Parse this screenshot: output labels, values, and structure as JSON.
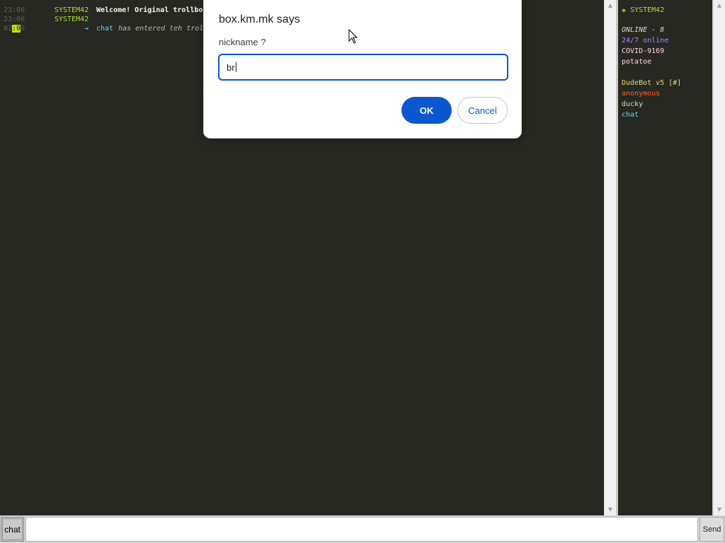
{
  "chat_log": [
    {
      "time": "23:06",
      "nick": "SYSTEM42",
      "nick_color": "#a6e22e",
      "text": "Welcome! Original trollbo"
    },
    {
      "time": "23:06",
      "nick": "SYSTEM42",
      "nick_color": "#a6e22e",
      "text": ""
    },
    {
      "time_pre": "02",
      "time_hl": ":0",
      "time_post": "6",
      "arrow": "→",
      "nick": "chat",
      "nick_color": "#66d9ef",
      "text": "has entered teh trol"
    }
  ],
  "users": {
    "owner": {
      "icon": "♚",
      "name": "SYSTEM42",
      "color": "#a6e22e"
    },
    "online_label": "ONLINE - 8",
    "list": [
      {
        "name": "24/7 online",
        "color": "#ae81ff"
      },
      {
        "name": "COVID-9169",
        "color": "#ffd6e6"
      },
      {
        "name": "potatoe",
        "color": "#ffd6e6"
      },
      {
        "name": "DudeBot v5 [#]",
        "color": "#e6db74"
      },
      {
        "name": "anonymous",
        "color": "#fd5f1e"
      },
      {
        "name": "ducky",
        "color": "#d8d8d0"
      },
      {
        "name": "chat",
        "color": "#66d9ef"
      }
    ]
  },
  "input_bar": {
    "nick_label": "chat",
    "message_value": "",
    "send_label": "Send"
  },
  "dialog": {
    "title": "box.km.mk says",
    "message": "nickname ?",
    "input_value": "br",
    "ok_label": "OK",
    "cancel_label": "Cancel"
  },
  "scrollbar": {
    "up_icon": "▲",
    "down_icon": "▼"
  },
  "colors": {
    "background": "#272822",
    "accent_blue": "#0b57d0",
    "highlight": "#c6e10b"
  }
}
